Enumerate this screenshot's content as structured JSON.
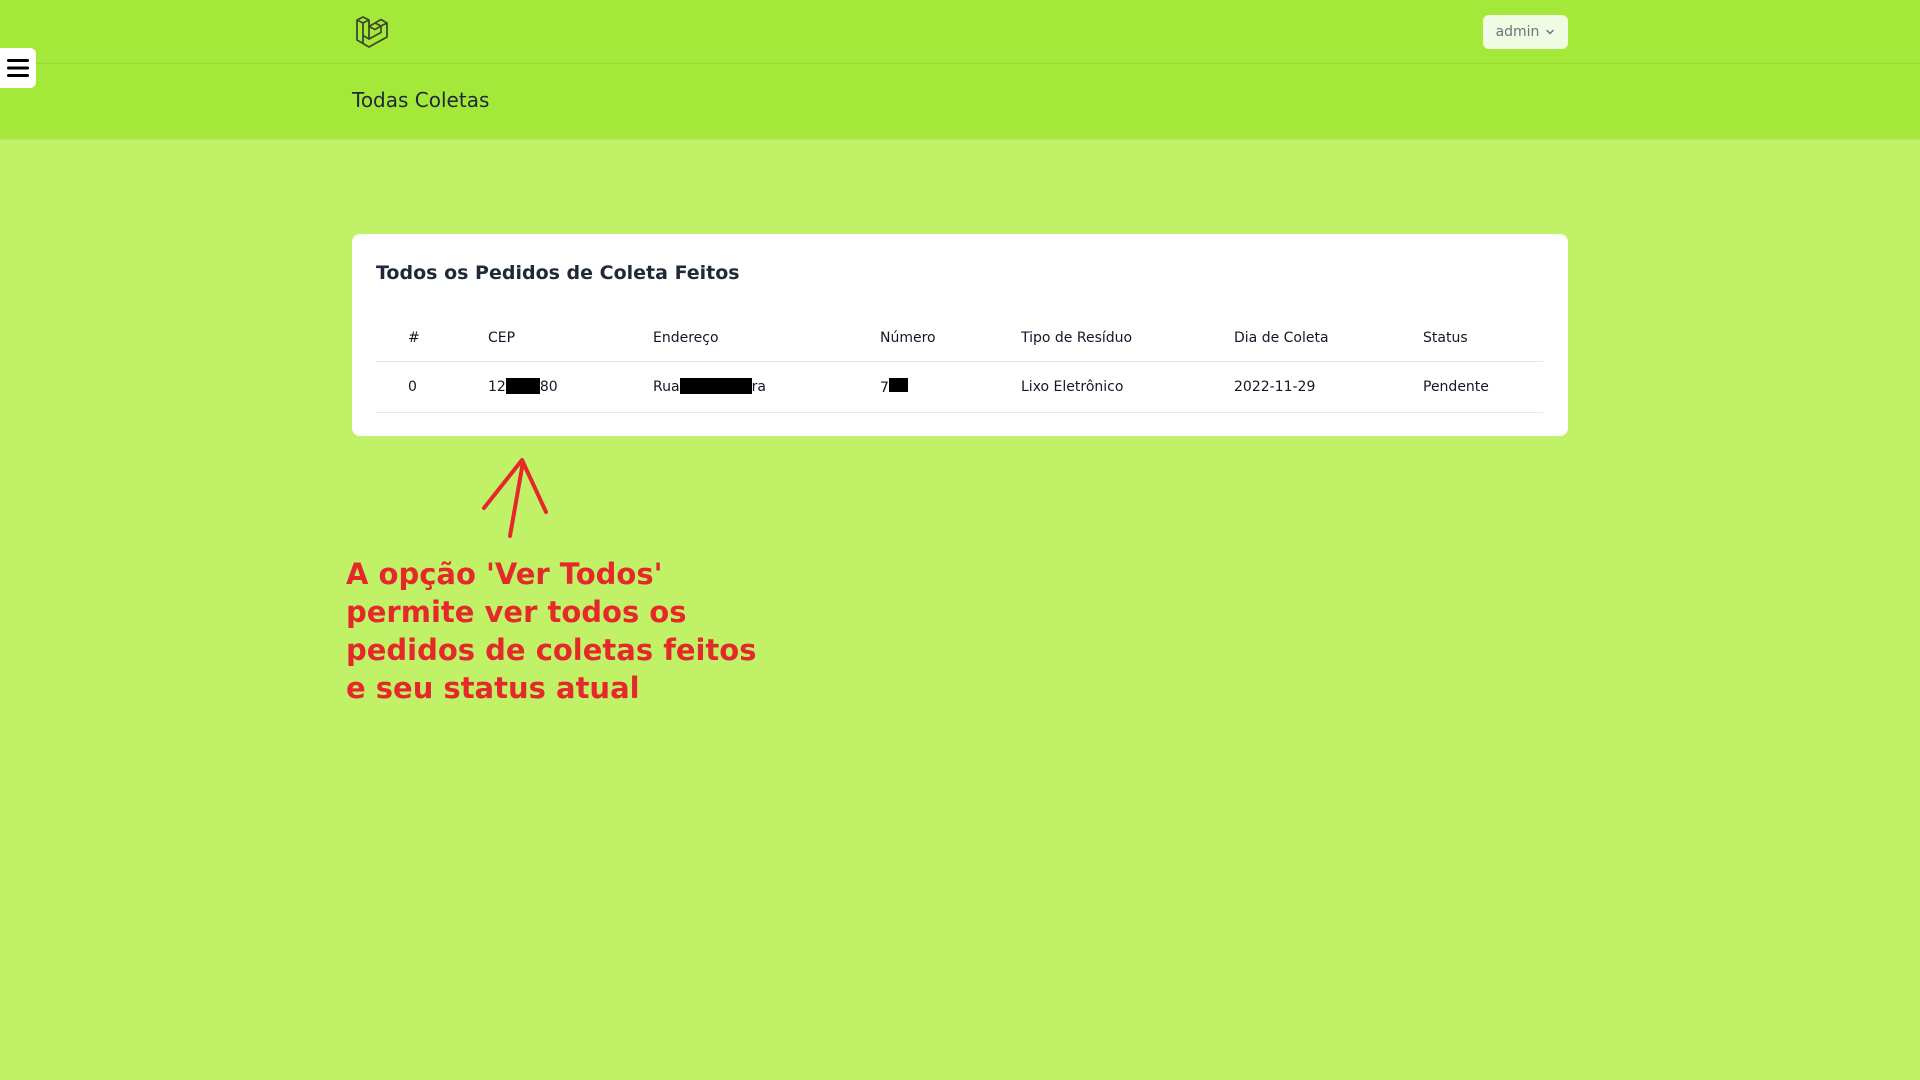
{
  "header": {
    "logo_icon": "laravel-logo-icon",
    "page_title": "Todas Coletas",
    "user_menu": {
      "label": "admin",
      "icon": "chevron-down-icon"
    },
    "menu_icon": "hamburger-menu-icon",
    "colors": {
      "topbar": "#a4e93a",
      "page_background": "#c1f167"
    }
  },
  "card": {
    "title": "Todos os Pedidos de Coleta Feitos",
    "table": {
      "columns": [
        "#",
        "CEP",
        "Endereço",
        "Número",
        "Tipo de Resíduo",
        "Dia de Coleta",
        "Status"
      ],
      "rows": [
        {
          "index": "0",
          "cep_prefix": "12",
          "cep_suffix": "80",
          "address_prefix": "Rua",
          "address_suffix": "ra",
          "number_prefix": "7",
          "waste_type": "Lixo Eletrônico",
          "collection_day": "2022-11-29",
          "status": "Pendente"
        }
      ]
    }
  },
  "annotation": {
    "lines": [
      "A opção 'Ver Todos'",
      "permite ver todos os",
      "pedidos de coletas feitos",
      "e seu status atual"
    ],
    "color": "#e5282a"
  }
}
